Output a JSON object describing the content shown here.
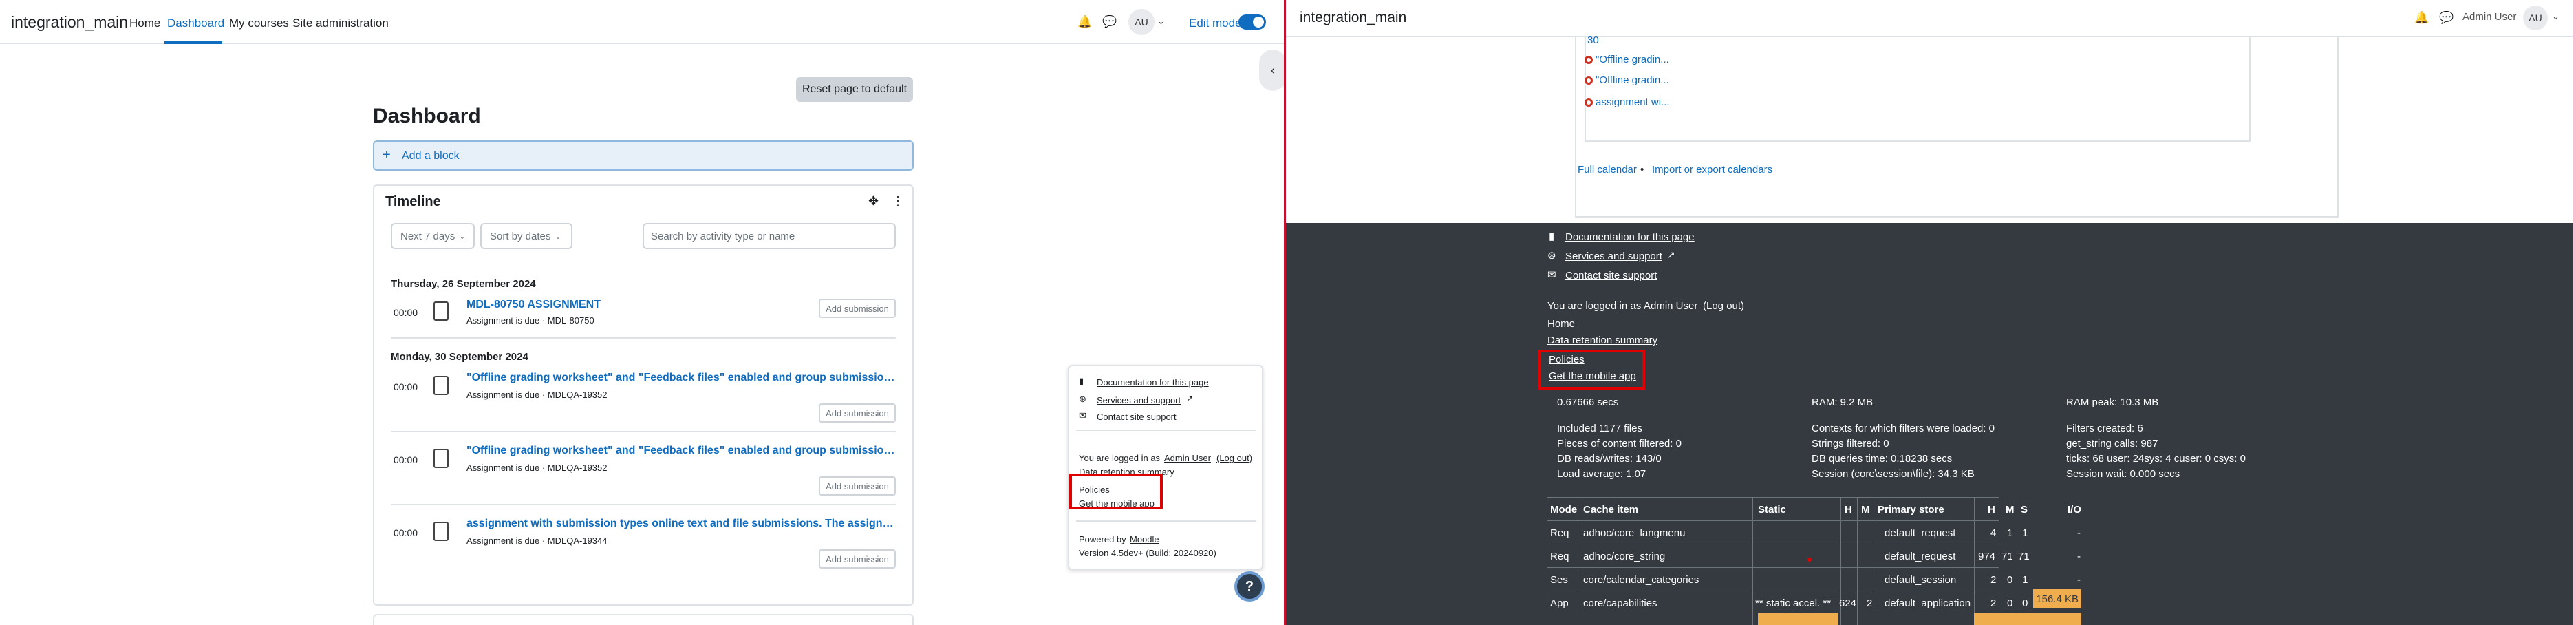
{
  "left": {
    "nav": {
      "brand": "integration_main",
      "links": [
        "Home",
        "Dashboard",
        "My courses",
        "Site administration"
      ],
      "avatar": "AU",
      "edit_mode": "Edit mode"
    },
    "reset_button": "Reset page to default",
    "page_title": "Dashboard",
    "add_block": "Add a block",
    "timeline": {
      "title": "Timeline",
      "filter_days": "Next 7 days",
      "sort": "Sort by dates",
      "search_placeholder": "Search by activity type or name",
      "groups": [
        {
          "date": "Thursday, 26 September 2024",
          "events": [
            {
              "time": "00:00",
              "title": "MDL-80750 ASSIGNMENT",
              "sub": "Assignment is due · MDL-80750",
              "action": "Add submission"
            }
          ]
        },
        {
          "date": "Monday, 30 September 2024",
          "events": [
            {
              "time": "00:00",
              "title": "\"Offline grading worksheet\" and \"Feedback files\" enabled and group submission dis...",
              "sub": "Assignment is due · MDLQA-19352",
              "action": "Add submission"
            },
            {
              "time": "00:00",
              "title": "\"Offline grading worksheet\" and \"Feedback files\" enabled and group submission dis...",
              "sub": "Assignment is due · MDLQA-19352",
              "action": "Add submission"
            },
            {
              "time": "00:00",
              "title": "assignment with submission types online text and file submissions. The assignment ...",
              "sub": "Assignment is due · MDLQA-19344",
              "action": "Add submission"
            }
          ]
        }
      ]
    },
    "footer_popover": {
      "doc_link": "Documentation for this page",
      "services_link": "Services and support",
      "contact_link": "Contact site support",
      "logged_in_prefix": "You are logged in as",
      "user": "Admin User",
      "logout": "(Log out)",
      "data_retention": "Data retention summary",
      "policies": "Policies",
      "mobile_app": "Get the mobile app",
      "powered_by_prefix": "Powered by",
      "moodle": "Moodle",
      "version": "Version 4.5dev+ (Build: 20240920)"
    },
    "help_icon": "?"
  },
  "right": {
    "nav": {
      "brand": "integration_main",
      "user_name": "Admin User",
      "avatar": "AU"
    },
    "calendar": {
      "day_number": "30",
      "items": [
        "\"Offline gradin...",
        "\"Offline gradin...",
        "assignment wi..."
      ],
      "full_calendar": "Full calendar",
      "bullet": " • ",
      "import_export": "Import or export calendars"
    },
    "footer": {
      "doc_link": "Documentation for this page",
      "services_link": "Services and support",
      "contact_link": "Contact site support",
      "logged_in_prefix": "You are logged in as",
      "user": "Admin User",
      "logout": "(Log out)",
      "home": "Home",
      "data_retention": "Data retention summary",
      "policies": "Policies",
      "mobile_app": "Get the mobile app",
      "perf": {
        "secs": "0.67666 secs",
        "ram": "RAM: 9.2 MB",
        "ram_peak": "RAM peak: 10.3 MB",
        "included": "Included 1177 files",
        "contexts": "Contexts for which filters were loaded: 0",
        "filters_created": "Filters created: 6",
        "pieces": "Pieces of content filtered: 0",
        "strings": "Strings filtered: 0",
        "get_string": "get_string calls: 987",
        "db_rw": "DB reads/writes: 143/0",
        "db_time": "DB queries time: 0.18238 secs",
        "ticks": "ticks: 68 user: 24sys: 4 cuser: 0 csys: 0",
        "load": "Load average: 1.07",
        "session": "Session (core\\session\\file): 34.3 KB",
        "session_wait": "Session wait: 0.000 secs"
      },
      "table": {
        "headers": [
          "Mode",
          "Cache item",
          "Static",
          "H",
          "M",
          "Primary store",
          "H",
          "M",
          "S",
          "I/O"
        ],
        "rows": [
          [
            "Req",
            "adhoc/core_langmenu",
            "",
            "",
            "",
            "default_request",
            "4",
            "1",
            "1",
            "-"
          ],
          [
            "Req",
            "adhoc/core_string",
            "",
            "",
            "",
            "default_request",
            "974",
            "71",
            "71",
            "-"
          ],
          [
            "Ses",
            "core/calendar_categories",
            "",
            "",
            "",
            "default_session",
            "2",
            "0",
            "1",
            "-"
          ],
          [
            "App",
            "core/capabilities",
            "** static accel. **",
            "624",
            "2",
            "default_application",
            "2",
            "0",
            "0",
            "156.4 KB"
          ]
        ]
      }
    }
  }
}
